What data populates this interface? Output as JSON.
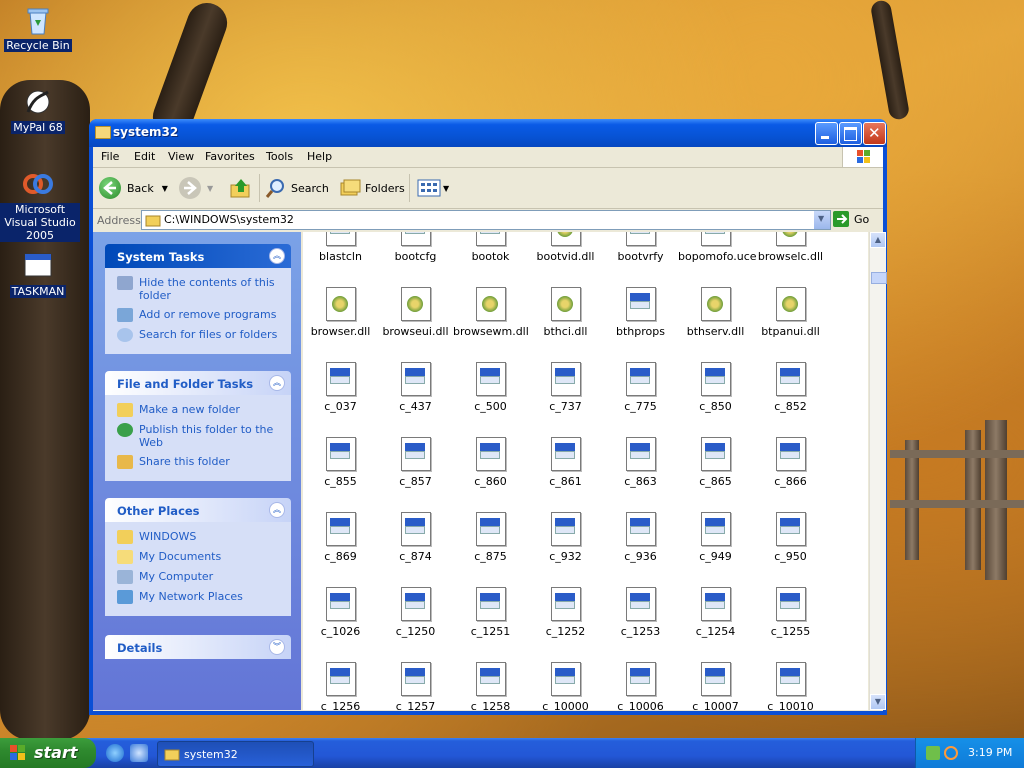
{
  "desktop": {
    "icons": [
      {
        "label": "Recycle Bin"
      },
      {
        "label": "MyPal 68"
      },
      {
        "label": "Microsoft Visual Studio 2005"
      },
      {
        "label": "TASKMAN"
      }
    ]
  },
  "window": {
    "title": "system32",
    "menu": [
      "File",
      "Edit",
      "View",
      "Favorites",
      "Tools",
      "Help"
    ],
    "toolbar": {
      "back": "Back",
      "search": "Search",
      "folders": "Folders"
    },
    "address": {
      "label": "Address",
      "value": "C:\\WINDOWS\\system32",
      "go": "Go"
    }
  },
  "taskpane": {
    "system_tasks": {
      "title": "System Tasks",
      "items": [
        "Hide the contents of this folder",
        "Add or remove programs",
        "Search for files or folders"
      ]
    },
    "file_folder_tasks": {
      "title": "File and Folder Tasks",
      "items": [
        "Make a new folder",
        "Publish this folder to the Web",
        "Share this folder"
      ]
    },
    "other_places": {
      "title": "Other Places",
      "items": [
        "WINDOWS",
        "My Documents",
        "My Computer",
        "My Network Places"
      ]
    },
    "details": {
      "title": "Details"
    }
  },
  "files": [
    [
      "blastcln",
      "bootcfg",
      "bootok",
      "bootvid.dll",
      "bootvrfy",
      "bopomofo.uce",
      "browselc.dll"
    ],
    [
      "browser.dll",
      "browseui.dll",
      "browsewm.dll",
      "bthci.dll",
      "bthprops",
      "bthserv.dll",
      "btpanui.dll"
    ],
    [
      "c_037",
      "c_437",
      "c_500",
      "c_737",
      "c_775",
      "c_850",
      "c_852"
    ],
    [
      "c_855",
      "c_857",
      "c_860",
      "c_861",
      "c_863",
      "c_865",
      "c_866"
    ],
    [
      "c_869",
      "c_874",
      "c_875",
      "c_932",
      "c_936",
      "c_949",
      "c_950"
    ],
    [
      "c_1026",
      "c_1250",
      "c_1251",
      "c_1252",
      "c_1253",
      "c_1254",
      "c_1255"
    ],
    [
      "c_1256",
      "c_1257",
      "c_1258",
      "c_10000",
      "c_10006",
      "c_10007",
      "c_10010"
    ]
  ],
  "taskbar": {
    "start": "start",
    "task": "system32",
    "clock": "3:19 PM"
  }
}
